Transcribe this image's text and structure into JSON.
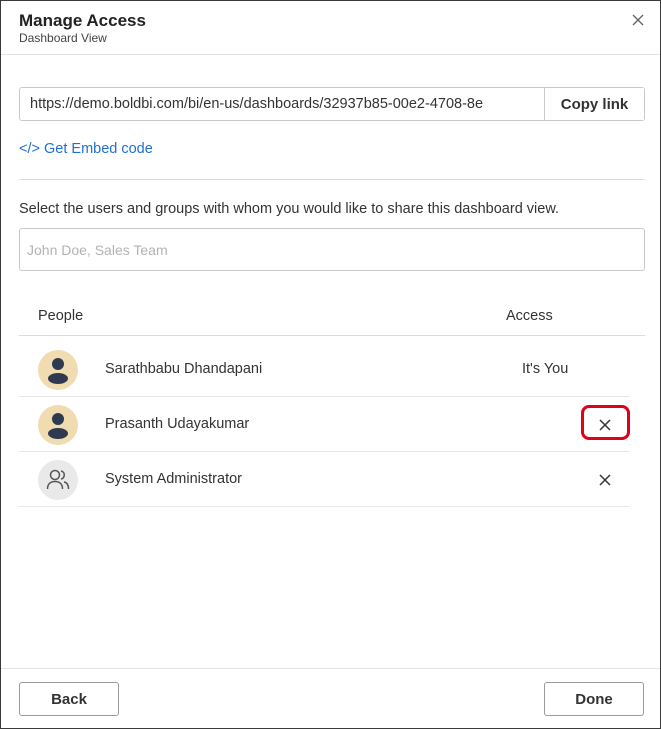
{
  "dialog": {
    "title": "Manage Access",
    "subtitle": "Dashboard View",
    "close_icon": "close-icon"
  },
  "share_link": {
    "value": "https://demo.boldbi.com/bi/en-us/dashboards/32937b85-00e2-4708-8e",
    "copy_label": "Copy link"
  },
  "embed": {
    "label": "</> Get Embed code"
  },
  "share": {
    "instructions": "Select the users and groups with whom you would like to share this dashboard view.",
    "placeholder": "John Doe, Sales Team"
  },
  "table": {
    "headers": {
      "people": "People",
      "access": "Access"
    },
    "rows": [
      {
        "name": "Sarathbabu Dhandapani",
        "access": "It's You",
        "avatar": "user-avatar-icon"
      },
      {
        "name": "Prasanth Udayakumar",
        "access": "",
        "avatar": "user-avatar-icon",
        "action": "remove-icon"
      },
      {
        "name": "System Administrator",
        "access": "",
        "avatar": "group-icon",
        "action": "remove-icon"
      }
    ]
  },
  "footer": {
    "back_label": "Back",
    "done_label": "Done"
  },
  "colors": {
    "link": "#1f6fd1",
    "user_avatar_bg": "#f1dcb2",
    "avatar_glyph": "#2e3a4f",
    "highlight": "#e0001b"
  }
}
